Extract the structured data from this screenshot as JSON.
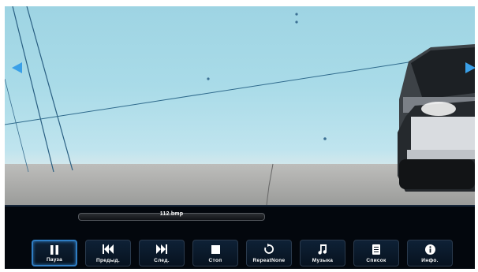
{
  "player": {
    "file_name": "112.bmp",
    "accent_color": "#2f7dc3",
    "arrow_color": "#3aa0e8"
  },
  "controls": [
    {
      "id": "pause",
      "label": "Пауза",
      "icon": "pause-icon",
      "selected": true
    },
    {
      "id": "prev",
      "label": "Предыд.",
      "icon": "skip-previous-icon",
      "selected": false
    },
    {
      "id": "next",
      "label": "След.",
      "icon": "skip-next-icon",
      "selected": false
    },
    {
      "id": "stop",
      "label": "Стоп",
      "icon": "stop-icon",
      "selected": false
    },
    {
      "id": "repeat",
      "label": "RepeatNone",
      "icon": "repeat-icon",
      "selected": false
    },
    {
      "id": "music",
      "label": "Музыка",
      "icon": "music-note-icon",
      "selected": false
    },
    {
      "id": "list",
      "label": "Список",
      "icon": "list-icon",
      "selected": false
    },
    {
      "id": "info",
      "label": "Инфо.",
      "icon": "info-icon",
      "selected": false
    }
  ],
  "nav": {
    "left_icon": "arrow-left-icon",
    "right_icon": "arrow-right-icon"
  }
}
